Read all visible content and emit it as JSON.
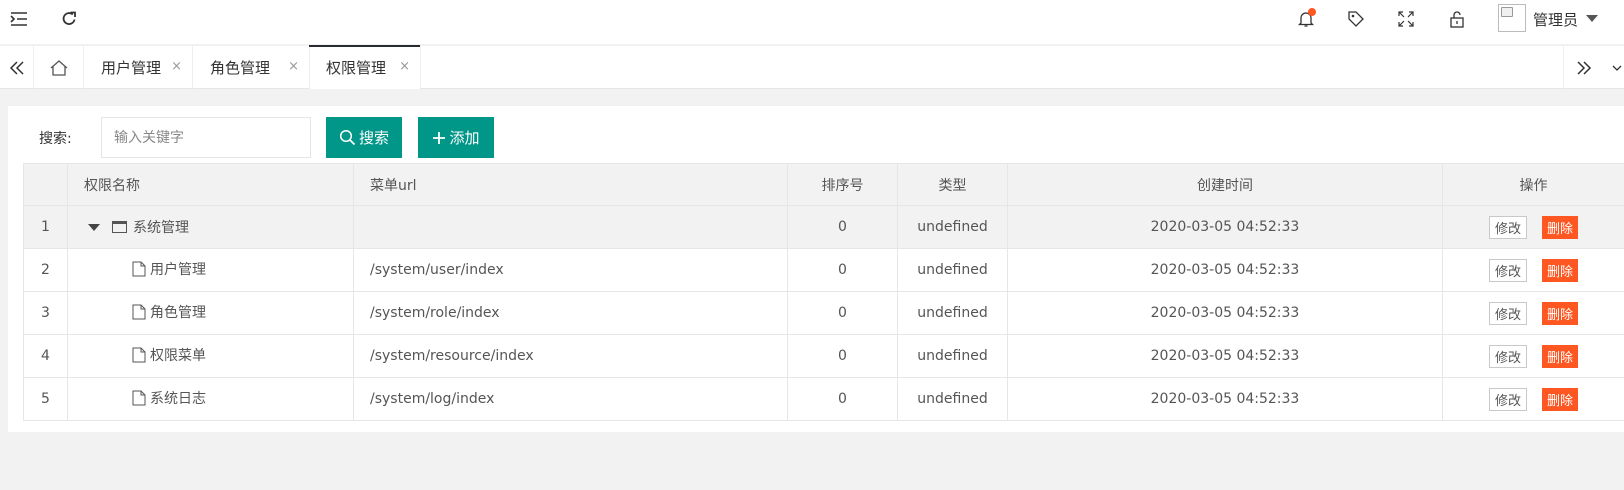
{
  "header": {
    "user_name": "管理员",
    "icons": [
      "menu-fold-icon",
      "refresh-icon",
      "bell-icon",
      "tag-icon",
      "fullscreen-icon",
      "lock-icon"
    ]
  },
  "tabs": [
    {
      "label": "用户管理",
      "close": "×"
    },
    {
      "label": "角色管理",
      "close": "×"
    },
    {
      "label": "权限管理",
      "close": "×"
    }
  ],
  "search": {
    "label": "搜索:",
    "placeholder": "输入关键字",
    "search_button": "搜索",
    "add_button": "添加"
  },
  "table": {
    "headers": [
      "",
      "权限名称",
      "菜单url",
      "排序号",
      "类型",
      "创建时间",
      "操作"
    ],
    "rows": [
      {
        "index": "1",
        "name": "系统管理",
        "url": "",
        "sort": "0",
        "type": "undefined",
        "created": "2020-03-05 04:52:33",
        "edit": "修改",
        "delete": "删除"
      },
      {
        "index": "2",
        "name": "用户管理",
        "url": "/system/user/index",
        "sort": "0",
        "type": "undefined",
        "created": "2020-03-05 04:52:33",
        "edit": "修改",
        "delete": "删除"
      },
      {
        "index": "3",
        "name": "角色管理",
        "url": "/system/role/index",
        "sort": "0",
        "type": "undefined",
        "created": "2020-03-05 04:52:33",
        "edit": "修改",
        "delete": "删除"
      },
      {
        "index": "4",
        "name": "权限菜单",
        "url": "/system/resource/index",
        "sort": "0",
        "type": "undefined",
        "created": "2020-03-05 04:52:33",
        "edit": "修改",
        "delete": "删除"
      },
      {
        "index": "5",
        "name": "系统日志",
        "url": "/system/log/index",
        "sort": "0",
        "type": "undefined",
        "created": "2020-03-05 04:52:33",
        "edit": "修改",
        "delete": "删除"
      }
    ]
  },
  "colors": {
    "primary": "#009688",
    "danger": "#FF5722",
    "notify": "#FF5722"
  }
}
